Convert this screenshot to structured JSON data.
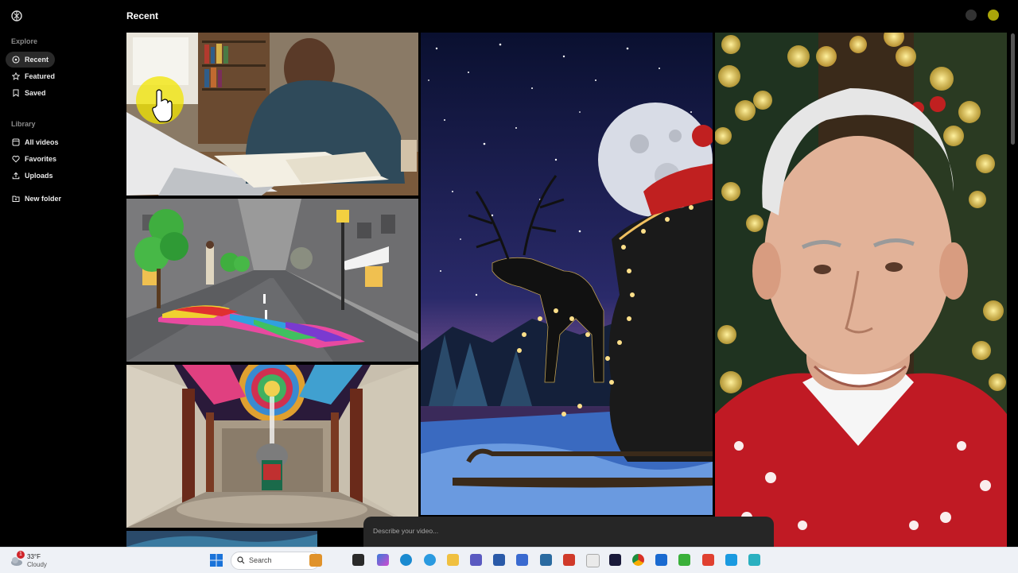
{
  "header": {
    "title": "Recent"
  },
  "sidebar": {
    "explore_label": "Explore",
    "explore_items": [
      {
        "label": "Recent",
        "icon": "clock-icon",
        "active": true
      },
      {
        "label": "Featured",
        "icon": "star-icon"
      },
      {
        "label": "Saved",
        "icon": "bookmark-icon"
      }
    ],
    "library_label": "Library",
    "library_items": [
      {
        "label": "All videos",
        "icon": "video-icon"
      },
      {
        "label": "Favorites",
        "icon": "heart-icon"
      },
      {
        "label": "Uploads",
        "icon": "upload-icon"
      },
      {
        "label": "New folder",
        "icon": "folder-plus-icon"
      }
    ]
  },
  "grid": {
    "tiles": [
      {
        "name": "tile-student-studying",
        "icon": "video-thumbnail"
      },
      {
        "name": "tile-rainbow-street",
        "icon": "video-thumbnail"
      },
      {
        "name": "tile-elephant-hall",
        "icon": "video-thumbnail"
      },
      {
        "name": "tile-santa-sleigh",
        "icon": "video-thumbnail"
      },
      {
        "name": "tile-smiling-man",
        "icon": "video-thumbnail"
      }
    ]
  },
  "prompt": {
    "placeholder": "Describe your video..."
  },
  "taskbar": {
    "weather_temp": "33°F",
    "weather_desc": "Cloudy",
    "weather_badge": "1",
    "search_label": "Search"
  },
  "colors": {
    "background": "#000000",
    "active_nav": "#2a2a2a",
    "cursor_highlight": "#f2e600",
    "taskbar": "#eef1f6"
  }
}
